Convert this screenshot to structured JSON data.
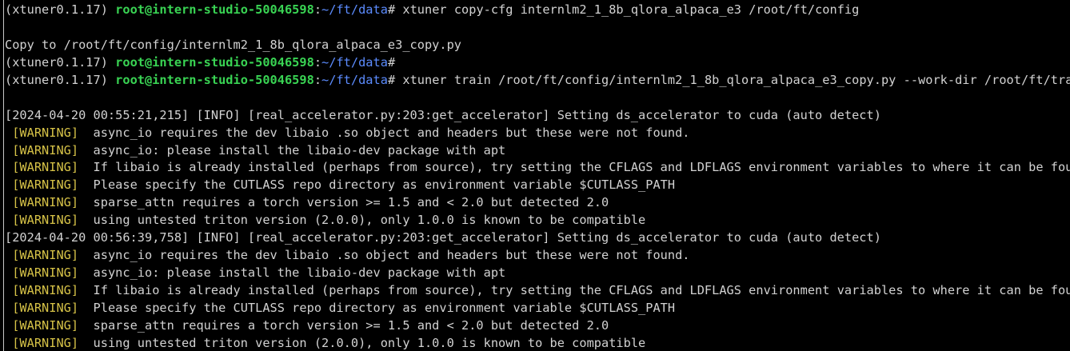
{
  "colors": {
    "background": "#000000",
    "text": "#d2d2d2",
    "user_host": "#39d353",
    "path": "#5c8cff",
    "warning": "#d6c247"
  },
  "prompt": {
    "env": "(xtuner0.1.17) ",
    "user_host": "root@intern-studio-50046598",
    "sep": ":",
    "path": "~/ft/data",
    "symbol": "# "
  },
  "lines": [
    {
      "type": "prompt",
      "cmd": "xtuner copy-cfg internlm2_1_8b_qlora_alpaca_e3 /root/ft/config"
    },
    {
      "type": "blank"
    },
    {
      "type": "text",
      "text": "Copy to /root/ft/config/internlm2_1_8b_qlora_alpaca_e3_copy.py"
    },
    {
      "type": "prompt_nospace",
      "cmd": ""
    },
    {
      "type": "prompt",
      "cmd": "xtuner train /root/ft/config/internlm2_1_8b_qlora_alpaca_e3_copy.py --work-dir /root/ft/train"
    },
    {
      "type": "blank"
    },
    {
      "type": "text",
      "text": "[2024-04-20 00:55:21,215] [INFO] [real_accelerator.py:203:get_accelerator] Setting ds_accelerator to cuda (auto detect)"
    },
    {
      "type": "warn",
      "tag": "[WARNING]",
      "text": "  async_io requires the dev libaio .so object and headers but these were not found."
    },
    {
      "type": "warn",
      "tag": "[WARNING]",
      "text": "  async_io: please install the libaio-dev package with apt"
    },
    {
      "type": "warn",
      "tag": "[WARNING]",
      "text": "  If libaio is already installed (perhaps from source), try setting the CFLAGS and LDFLAGS environment variables to where it can be found."
    },
    {
      "type": "warn",
      "tag": "[WARNING]",
      "text": "  Please specify the CUTLASS repo directory as environment variable $CUTLASS_PATH"
    },
    {
      "type": "warn",
      "tag": "[WARNING]",
      "text": "  sparse_attn requires a torch version >= 1.5 and < 2.0 but detected 2.0"
    },
    {
      "type": "warn",
      "tag": "[WARNING]",
      "text": "  using untested triton version (2.0.0), only 1.0.0 is known to be compatible"
    },
    {
      "type": "text",
      "text": "[2024-04-20 00:56:39,758] [INFO] [real_accelerator.py:203:get_accelerator] Setting ds_accelerator to cuda (auto detect)"
    },
    {
      "type": "warn",
      "tag": "[WARNING]",
      "text": "  async_io requires the dev libaio .so object and headers but these were not found."
    },
    {
      "type": "warn",
      "tag": "[WARNING]",
      "text": "  async_io: please install the libaio-dev package with apt"
    },
    {
      "type": "warn",
      "tag": "[WARNING]",
      "text": "  If libaio is already installed (perhaps from source), try setting the CFLAGS and LDFLAGS environment variables to where it can be found."
    },
    {
      "type": "warn",
      "tag": "[WARNING]",
      "text": "  Please specify the CUTLASS repo directory as environment variable $CUTLASS_PATH"
    },
    {
      "type": "warn",
      "tag": "[WARNING]",
      "text": "  sparse_attn requires a torch version >= 1.5 and < 2.0 but detected 2.0"
    },
    {
      "type": "warn",
      "tag": "[WARNING]",
      "text": "  using untested triton version (2.0.0), only 1.0.0 is known to be compatible"
    }
  ]
}
